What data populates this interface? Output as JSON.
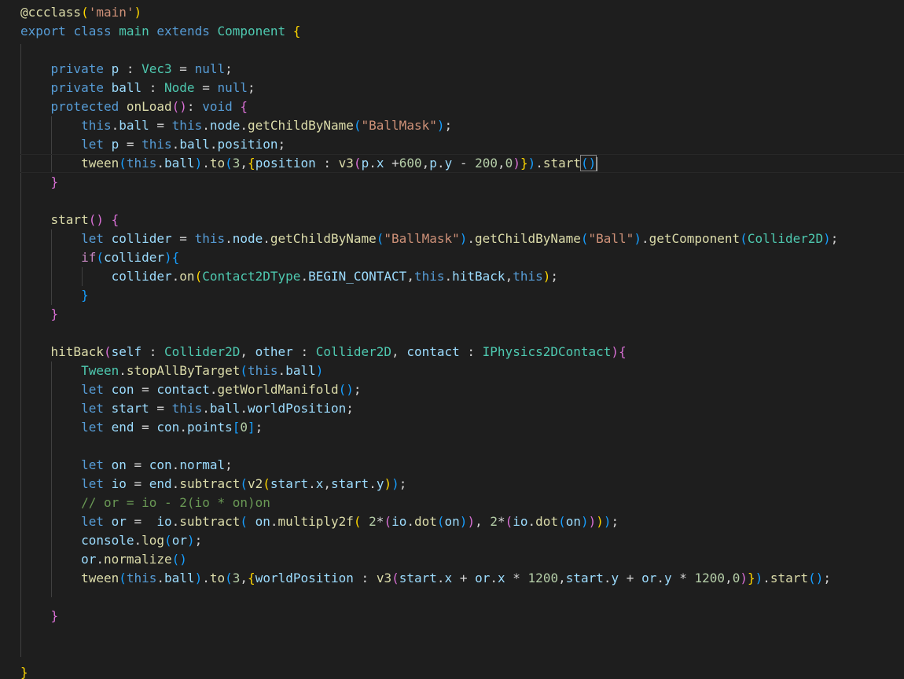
{
  "editor": {
    "colors": {
      "background": "#1e1e1e",
      "keyword": "#569cd6",
      "control": "#c586c0",
      "type": "#4ec9b0",
      "function": "#dcdcaa",
      "variable": "#9cdcfe",
      "string": "#ce9178",
      "number": "#b5cea8",
      "comment": "#6a9955",
      "bracket_level_1": "#ffd700",
      "bracket_level_2": "#da70d6",
      "bracket_level_3": "#179fff"
    },
    "cursor_line": 8,
    "lines": [
      [
        [
          "fn",
          "@ccclass"
        ],
        [
          "b1",
          "("
        ],
        [
          "str",
          "'main'"
        ],
        [
          "b1",
          ")"
        ]
      ],
      [
        [
          "kw",
          "export "
        ],
        [
          "kw",
          "class "
        ],
        [
          "ty",
          "main "
        ],
        [
          "kw",
          "extends "
        ],
        [
          "ty",
          "Component "
        ],
        [
          "b1",
          "{"
        ]
      ],
      [],
      [
        [
          "pun",
          "    "
        ],
        [
          "kw",
          "private "
        ],
        [
          "var",
          "p"
        ],
        [
          "pun",
          " : "
        ],
        [
          "ty",
          "Vec3"
        ],
        [
          "pun",
          " = "
        ],
        [
          "kw",
          "null"
        ],
        [
          "pun",
          ";"
        ]
      ],
      [
        [
          "pun",
          "    "
        ],
        [
          "kw",
          "private "
        ],
        [
          "var",
          "ball"
        ],
        [
          "pun",
          " : "
        ],
        [
          "ty",
          "Node"
        ],
        [
          "pun",
          " = "
        ],
        [
          "kw",
          "null"
        ],
        [
          "pun",
          ";"
        ]
      ],
      [
        [
          "pun",
          "    "
        ],
        [
          "kw",
          "protected "
        ],
        [
          "fn",
          "onLoad"
        ],
        [
          "b2",
          "()"
        ],
        [
          "pun",
          ": "
        ],
        [
          "kw",
          "void "
        ],
        [
          "b2",
          "{"
        ]
      ],
      [
        [
          "pun",
          "        "
        ],
        [
          "kw",
          "this"
        ],
        [
          "pun",
          "."
        ],
        [
          "var",
          "ball"
        ],
        [
          "pun",
          " = "
        ],
        [
          "kw",
          "this"
        ],
        [
          "pun",
          "."
        ],
        [
          "var",
          "node"
        ],
        [
          "pun",
          "."
        ],
        [
          "fn",
          "getChildByName"
        ],
        [
          "b3",
          "("
        ],
        [
          "str",
          "\"BallMask\""
        ],
        [
          "b3",
          ")"
        ],
        [
          "pun",
          ";"
        ]
      ],
      [
        [
          "pun",
          "        "
        ],
        [
          "kw",
          "let "
        ],
        [
          "var",
          "p"
        ],
        [
          "pun",
          " = "
        ],
        [
          "kw",
          "this"
        ],
        [
          "pun",
          "."
        ],
        [
          "var",
          "ball"
        ],
        [
          "pun",
          "."
        ],
        [
          "var",
          "position"
        ],
        [
          "pun",
          ";"
        ]
      ],
      [
        [
          "pun",
          "        "
        ],
        [
          "fn",
          "tween"
        ],
        [
          "b3",
          "("
        ],
        [
          "kw",
          "this"
        ],
        [
          "pun",
          "."
        ],
        [
          "var",
          "ball"
        ],
        [
          "b3",
          ")"
        ],
        [
          "pun",
          "."
        ],
        [
          "fn",
          "to"
        ],
        [
          "b3",
          "("
        ],
        [
          "num",
          "3"
        ],
        [
          "pun",
          ","
        ],
        [
          "b1",
          "{"
        ],
        [
          "var",
          "position"
        ],
        [
          "pun",
          " : "
        ],
        [
          "fn",
          "v3"
        ],
        [
          "b2",
          "("
        ],
        [
          "var",
          "p"
        ],
        [
          "pun",
          "."
        ],
        [
          "var",
          "x"
        ],
        [
          "pun",
          " +"
        ],
        [
          "num",
          "600"
        ],
        [
          "pun",
          ","
        ],
        [
          "var",
          "p"
        ],
        [
          "pun",
          "."
        ],
        [
          "var",
          "y"
        ],
        [
          "pun",
          " - "
        ],
        [
          "num",
          "200"
        ],
        [
          "pun",
          ","
        ],
        [
          "num",
          "0"
        ],
        [
          "b2",
          ")"
        ],
        [
          "b1",
          "}"
        ],
        [
          "b3",
          ")"
        ],
        [
          "pun",
          "."
        ],
        [
          "fn",
          "start"
        ],
        [
          "b3box",
          "()"
        ],
        [
          "cursor",
          ""
        ]
      ],
      [
        [
          "pun",
          "    "
        ],
        [
          "b2",
          "}"
        ]
      ],
      [],
      [
        [
          "pun",
          "    "
        ],
        [
          "fn",
          "start"
        ],
        [
          "b2",
          "()"
        ],
        [
          "pun",
          " "
        ],
        [
          "b2",
          "{"
        ]
      ],
      [
        [
          "pun",
          "        "
        ],
        [
          "kw",
          "let "
        ],
        [
          "var",
          "collider"
        ],
        [
          "pun",
          " = "
        ],
        [
          "kw",
          "this"
        ],
        [
          "pun",
          "."
        ],
        [
          "var",
          "node"
        ],
        [
          "pun",
          "."
        ],
        [
          "fn",
          "getChildByName"
        ],
        [
          "b3",
          "("
        ],
        [
          "str",
          "\"BallMask\""
        ],
        [
          "b3",
          ")"
        ],
        [
          "pun",
          "."
        ],
        [
          "fn",
          "getChildByName"
        ],
        [
          "b3",
          "("
        ],
        [
          "str",
          "\"Ball\""
        ],
        [
          "b3",
          ")"
        ],
        [
          "pun",
          "."
        ],
        [
          "fn",
          "getComponent"
        ],
        [
          "b3",
          "("
        ],
        [
          "ty",
          "Collider2D"
        ],
        [
          "b3",
          ")"
        ],
        [
          "pun",
          ";"
        ]
      ],
      [
        [
          "pun",
          "        "
        ],
        [
          "ctl",
          "if"
        ],
        [
          "b3",
          "("
        ],
        [
          "var",
          "collider"
        ],
        [
          "b3",
          ")"
        ],
        [
          "b3",
          "{"
        ]
      ],
      [
        [
          "pun",
          "            "
        ],
        [
          "var",
          "collider"
        ],
        [
          "pun",
          "."
        ],
        [
          "fn",
          "on"
        ],
        [
          "b1",
          "("
        ],
        [
          "ty",
          "Contact2DType"
        ],
        [
          "pun",
          "."
        ],
        [
          "var",
          "BEGIN_CONTACT"
        ],
        [
          "pun",
          ","
        ],
        [
          "kw",
          "this"
        ],
        [
          "pun",
          "."
        ],
        [
          "var",
          "hitBack"
        ],
        [
          "pun",
          ","
        ],
        [
          "kw",
          "this"
        ],
        [
          "b1",
          ")"
        ],
        [
          "pun",
          ";"
        ]
      ],
      [
        [
          "pun",
          "        "
        ],
        [
          "b3",
          "}"
        ]
      ],
      [
        [
          "pun",
          "    "
        ],
        [
          "b2",
          "}"
        ]
      ],
      [],
      [
        [
          "pun",
          "    "
        ],
        [
          "fn",
          "hitBack"
        ],
        [
          "b2",
          "("
        ],
        [
          "var",
          "self"
        ],
        [
          "pun",
          " : "
        ],
        [
          "ty",
          "Collider2D"
        ],
        [
          "pun",
          ", "
        ],
        [
          "var",
          "other"
        ],
        [
          "pun",
          " : "
        ],
        [
          "ty",
          "Collider2D"
        ],
        [
          "pun",
          ", "
        ],
        [
          "var",
          "contact"
        ],
        [
          "pun",
          " : "
        ],
        [
          "ty",
          "IPhysics2DContact"
        ],
        [
          "b2",
          ")"
        ],
        [
          "b2",
          "{"
        ]
      ],
      [
        [
          "pun",
          "        "
        ],
        [
          "ty",
          "Tween"
        ],
        [
          "pun",
          "."
        ],
        [
          "fn",
          "stopAllByTarget"
        ],
        [
          "b3",
          "("
        ],
        [
          "kw",
          "this"
        ],
        [
          "pun",
          "."
        ],
        [
          "var",
          "ball"
        ],
        [
          "b3",
          ")"
        ]
      ],
      [
        [
          "pun",
          "        "
        ],
        [
          "kw",
          "let "
        ],
        [
          "var",
          "con"
        ],
        [
          "pun",
          " = "
        ],
        [
          "var",
          "contact"
        ],
        [
          "pun",
          "."
        ],
        [
          "fn",
          "getWorldManifold"
        ],
        [
          "b3",
          "()"
        ],
        [
          "pun",
          ";"
        ]
      ],
      [
        [
          "pun",
          "        "
        ],
        [
          "kw",
          "let "
        ],
        [
          "var",
          "start"
        ],
        [
          "pun",
          " = "
        ],
        [
          "kw",
          "this"
        ],
        [
          "pun",
          "."
        ],
        [
          "var",
          "ball"
        ],
        [
          "pun",
          "."
        ],
        [
          "var",
          "worldPosition"
        ],
        [
          "pun",
          ";"
        ]
      ],
      [
        [
          "pun",
          "        "
        ],
        [
          "kw",
          "let "
        ],
        [
          "var",
          "end"
        ],
        [
          "pun",
          " = "
        ],
        [
          "var",
          "con"
        ],
        [
          "pun",
          "."
        ],
        [
          "var",
          "points"
        ],
        [
          "b3",
          "["
        ],
        [
          "num",
          "0"
        ],
        [
          "b3",
          "]"
        ],
        [
          "pun",
          ";"
        ]
      ],
      [],
      [
        [
          "pun",
          "        "
        ],
        [
          "kw",
          "let "
        ],
        [
          "var",
          "on"
        ],
        [
          "pun",
          " = "
        ],
        [
          "var",
          "con"
        ],
        [
          "pun",
          "."
        ],
        [
          "var",
          "normal"
        ],
        [
          "pun",
          ";"
        ]
      ],
      [
        [
          "pun",
          "        "
        ],
        [
          "kw",
          "let "
        ],
        [
          "var",
          "io"
        ],
        [
          "pun",
          " = "
        ],
        [
          "var",
          "end"
        ],
        [
          "pun",
          "."
        ],
        [
          "fn",
          "subtract"
        ],
        [
          "b3",
          "("
        ],
        [
          "fn",
          "v2"
        ],
        [
          "b1",
          "("
        ],
        [
          "var",
          "start"
        ],
        [
          "pun",
          "."
        ],
        [
          "var",
          "x"
        ],
        [
          "pun",
          ","
        ],
        [
          "var",
          "start"
        ],
        [
          "pun",
          "."
        ],
        [
          "var",
          "y"
        ],
        [
          "b1",
          ")"
        ],
        [
          "b3",
          ")"
        ],
        [
          "pun",
          ";"
        ]
      ],
      [
        [
          "pun",
          "        "
        ],
        [
          "com",
          "// or = io - 2(io * on)on"
        ]
      ],
      [
        [
          "pun",
          "        "
        ],
        [
          "kw",
          "let "
        ],
        [
          "var",
          "or"
        ],
        [
          "pun",
          " =  "
        ],
        [
          "var",
          "io"
        ],
        [
          "pun",
          "."
        ],
        [
          "fn",
          "subtract"
        ],
        [
          "b3",
          "("
        ],
        [
          "pun",
          " "
        ],
        [
          "var",
          "on"
        ],
        [
          "pun",
          "."
        ],
        [
          "fn",
          "multiply2f"
        ],
        [
          "b1",
          "("
        ],
        [
          "pun",
          " "
        ],
        [
          "num",
          "2"
        ],
        [
          "pun",
          "*"
        ],
        [
          "b2",
          "("
        ],
        [
          "var",
          "io"
        ],
        [
          "pun",
          "."
        ],
        [
          "fn",
          "dot"
        ],
        [
          "b3",
          "("
        ],
        [
          "var",
          "on"
        ],
        [
          "b3",
          ")"
        ],
        [
          "b2",
          ")"
        ],
        [
          "pun",
          ", "
        ],
        [
          "num",
          "2"
        ],
        [
          "pun",
          "*"
        ],
        [
          "b2",
          "("
        ],
        [
          "var",
          "io"
        ],
        [
          "pun",
          "."
        ],
        [
          "fn",
          "dot"
        ],
        [
          "b3",
          "("
        ],
        [
          "var",
          "on"
        ],
        [
          "b3",
          ")"
        ],
        [
          "b2",
          ")"
        ],
        [
          "b1",
          ")"
        ],
        [
          "b3",
          ")"
        ],
        [
          "pun",
          ";"
        ]
      ],
      [
        [
          "pun",
          "        "
        ],
        [
          "var",
          "console"
        ],
        [
          "pun",
          "."
        ],
        [
          "fn",
          "log"
        ],
        [
          "b3",
          "("
        ],
        [
          "var",
          "or"
        ],
        [
          "b3",
          ")"
        ],
        [
          "pun",
          ";"
        ]
      ],
      [
        [
          "pun",
          "        "
        ],
        [
          "var",
          "or"
        ],
        [
          "pun",
          "."
        ],
        [
          "fn",
          "normalize"
        ],
        [
          "b3",
          "()"
        ]
      ],
      [
        [
          "pun",
          "        "
        ],
        [
          "fn",
          "tween"
        ],
        [
          "b3",
          "("
        ],
        [
          "kw",
          "this"
        ],
        [
          "pun",
          "."
        ],
        [
          "var",
          "ball"
        ],
        [
          "b3",
          ")"
        ],
        [
          "pun",
          "."
        ],
        [
          "fn",
          "to"
        ],
        [
          "b3",
          "("
        ],
        [
          "num",
          "3"
        ],
        [
          "pun",
          ","
        ],
        [
          "b1",
          "{"
        ],
        [
          "var",
          "worldPosition"
        ],
        [
          "pun",
          " : "
        ],
        [
          "fn",
          "v3"
        ],
        [
          "b2",
          "("
        ],
        [
          "var",
          "start"
        ],
        [
          "pun",
          "."
        ],
        [
          "var",
          "x"
        ],
        [
          "pun",
          " + "
        ],
        [
          "var",
          "or"
        ],
        [
          "pun",
          "."
        ],
        [
          "var",
          "x"
        ],
        [
          "pun",
          " * "
        ],
        [
          "num",
          "1200"
        ],
        [
          "pun",
          ","
        ],
        [
          "var",
          "start"
        ],
        [
          "pun",
          "."
        ],
        [
          "var",
          "y"
        ],
        [
          "pun",
          " + "
        ],
        [
          "var",
          "or"
        ],
        [
          "pun",
          "."
        ],
        [
          "var",
          "y"
        ],
        [
          "pun",
          " * "
        ],
        [
          "num",
          "1200"
        ],
        [
          "pun",
          ","
        ],
        [
          "num",
          "0"
        ],
        [
          "b2",
          ")"
        ],
        [
          "b1",
          "}"
        ],
        [
          "b3",
          ")"
        ],
        [
          "pun",
          "."
        ],
        [
          "fn",
          "start"
        ],
        [
          "b3",
          "()"
        ],
        [
          "pun",
          ";"
        ]
      ],
      [],
      [
        [
          "pun",
          "    "
        ],
        [
          "b2",
          "}"
        ]
      ],
      [],
      [],
      [
        [
          "b1",
          "}"
        ]
      ]
    ]
  }
}
